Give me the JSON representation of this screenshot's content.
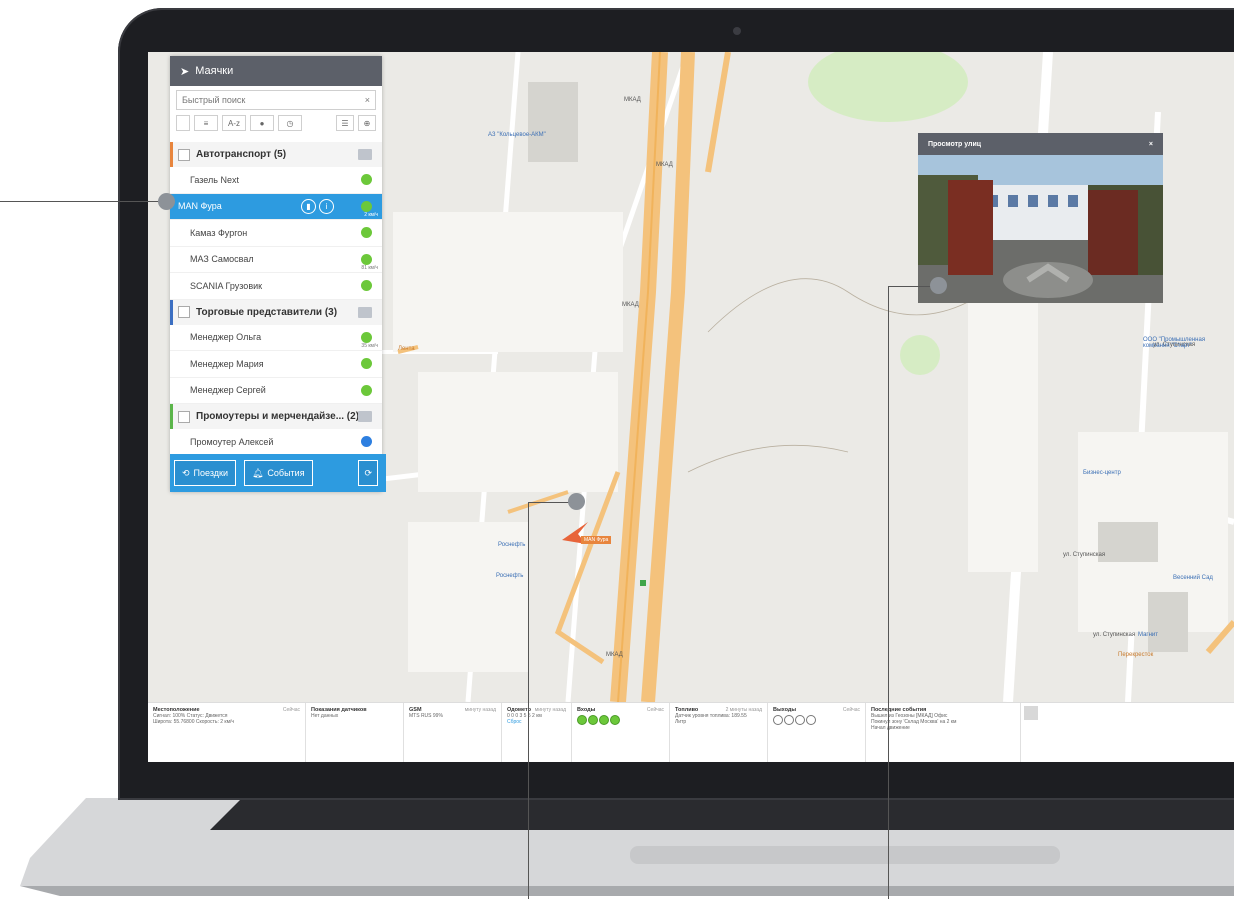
{
  "panel": {
    "title": "Маячки",
    "search_placeholder": "Быстрый поиск",
    "toolbar_sort": "A-z",
    "groups": [
      {
        "name": "Автотранспорт (5)",
        "color": "#e8853d",
        "items": [
          {
            "label": "Газель Next",
            "status": "green"
          },
          {
            "label": "MAN Фура",
            "status": "green",
            "speed": "2 км/ч",
            "selected": true
          },
          {
            "label": "Камаз Фургон",
            "status": "green"
          },
          {
            "label": "МАЗ Самосвал",
            "status": "green",
            "speed": "81 км/ч"
          },
          {
            "label": "SCANIA Грузовик",
            "status": "green"
          }
        ]
      },
      {
        "name": "Торговые представители (3)",
        "color": "#3c6fc2",
        "items": [
          {
            "label": "Менеджер Ольга",
            "status": "green",
            "speed": "35 км/ч"
          },
          {
            "label": "Менеджер Мария",
            "status": "green"
          },
          {
            "label": "Менеджер Сергей",
            "status": "green"
          }
        ]
      },
      {
        "name": "Промоутеры и мерчендайзе... (2)",
        "color": "#5bb54a",
        "items": [
          {
            "label": "Промоутер Алексей",
            "status": "blue"
          }
        ]
      }
    ],
    "footer": {
      "trips": "Поездки",
      "events": "События"
    }
  },
  "street_view": {
    "title": "Просмотр улиц",
    "close": "×"
  },
  "map": {
    "vehicle_label": "MAN Фура",
    "pois": [
      "АЗ \"Кольцевое-АКМ\"",
      "Роснефть",
      "Роснефть",
      "Лента",
      "Бизнес-центр",
      "Магнит",
      "Перекресток",
      "ООО \"Промышленная компания \"Старт\"",
      "Весенний Сад"
    ],
    "streets": [
      "МКАД",
      "МКАД",
      "МКАД",
      "МКАД",
      "ул. Ступинская",
      "ул. Ступинская",
      "ул. Ступинская"
    ]
  },
  "info_bar": [
    {
      "title": "Местоположение",
      "right": "Сейчас",
      "lines": [
        "Сигнал: 100%  Статус: Движется",
        "Широта: 55.76800  Скорость: 2 км/ч"
      ]
    },
    {
      "title": "Показания датчиков",
      "right": "",
      "lines": [
        "Нет данных"
      ]
    },
    {
      "title": "GSM",
      "right": "минуту назад",
      "lines": [
        "MTS RUS 99%"
      ]
    },
    {
      "title": "Одометр",
      "right": "минуту назад",
      "lines": [
        "0 0 0 3 5 5 2 км",
        "Сброс"
      ]
    },
    {
      "title": "Входы",
      "right": "Сейчас",
      "lines": []
    },
    {
      "title": "Топливо",
      "right": "2 минуты назад",
      "lines": [
        "Датчик уровня топлива: 189.55",
        "Литр"
      ]
    },
    {
      "title": "Выходы",
      "right": "Сейчас",
      "lines": []
    },
    {
      "title": "Последние события",
      "right": "",
      "lines": [
        "Вышел из Геозоны [МКАД] Офис",
        "Покинул зону 'Склад Москва' на 2 км",
        "Начал движение"
      ]
    }
  ],
  "colors": {
    "accent": "#2d9be0",
    "panel_header": "#5c6069",
    "status_green": "#6cc83a",
    "status_blue": "#2d7fe0",
    "vehicle_marker": "#e8643a"
  }
}
